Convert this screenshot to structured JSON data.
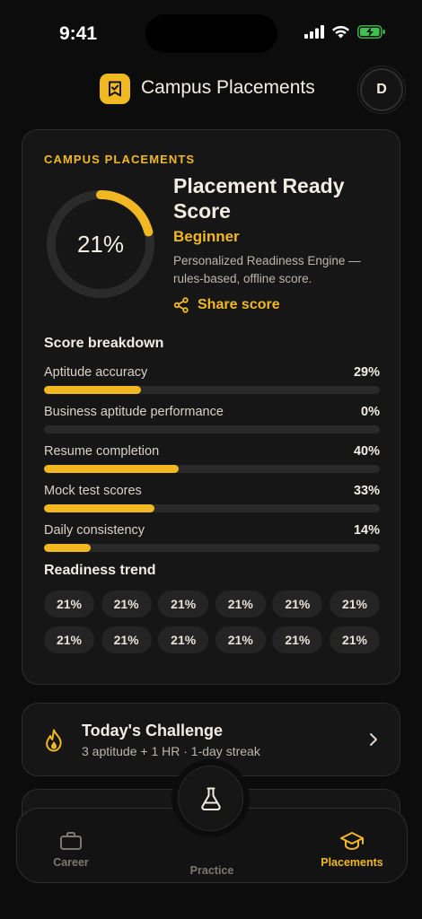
{
  "status": {
    "time": "9:41"
  },
  "header": {
    "title": "Campus Placements",
    "avatar_initial": "D"
  },
  "score_card": {
    "eyebrow": "CAMPUS PLACEMENTS",
    "percent_label": "21%",
    "percent_value": 21,
    "title": "Placement Ready Score",
    "level": "Beginner",
    "description": "Personalized Readiness Engine — rules-based, offline score.",
    "share_label": "Share score",
    "breakdown_title": "Score breakdown",
    "breakdown": [
      {
        "name": "Aptitude accuracy",
        "label": "29%",
        "value": 29
      },
      {
        "name": "Business aptitude performance",
        "label": "0%",
        "value": 0
      },
      {
        "name": "Resume completion",
        "label": "40%",
        "value": 40
      },
      {
        "name": "Mock test scores",
        "label": "33%",
        "value": 33
      },
      {
        "name": "Daily consistency",
        "label": "14%",
        "value": 14
      }
    ],
    "trend_title": "Readiness trend",
    "trend": [
      "21%",
      "21%",
      "21%",
      "21%",
      "21%",
      "21%",
      "21%",
      "21%",
      "21%",
      "21%",
      "21%",
      "21%"
    ]
  },
  "challenge": {
    "title": "Today's Challenge",
    "subtitle": "3 aptitude + 1 HR · 1-day streak"
  },
  "tabs": {
    "career": "Career",
    "practice": "Practice",
    "placements": "Placements"
  },
  "colors": {
    "accent": "#f2b822",
    "background": "#0c0c0d",
    "card": "#161616"
  }
}
